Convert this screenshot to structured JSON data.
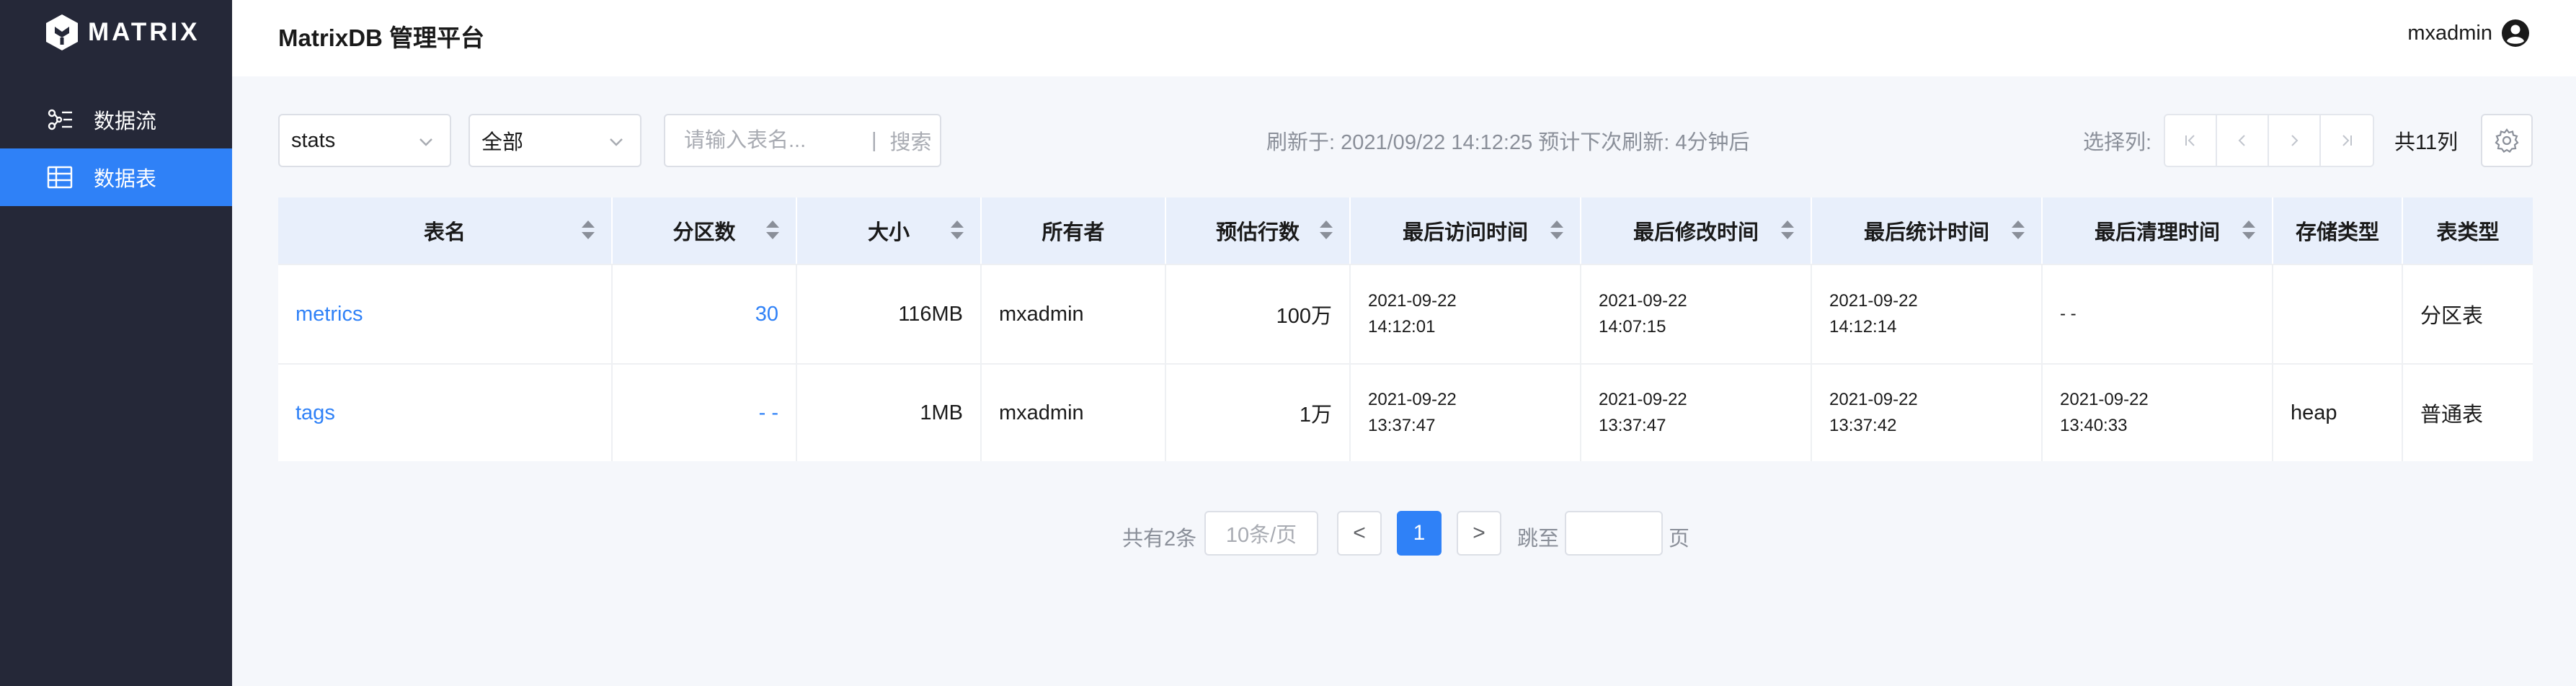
{
  "sidebar": {
    "logo_text": "MATRIX",
    "items": [
      {
        "label": "数据流",
        "icon": "data-flow-icon"
      },
      {
        "label": "数据表",
        "icon": "table-icon",
        "active": true
      }
    ]
  },
  "header": {
    "title": "MatrixDB 管理平台",
    "username": "mxadmin"
  },
  "toolbar": {
    "database_value": "stats",
    "type_value": "全部",
    "search_placeholder": "请输入表名...",
    "search_separator": "|",
    "search_button": "搜索",
    "refresh_info": "刷新于: 2021/09/22 14:12:25   预计下次刷新: 4分钟后",
    "column_select_label": "选择列:",
    "column_count": "共11列"
  },
  "table": {
    "columns": [
      "表名",
      "分区数",
      "大小",
      "所有者",
      "预估行数",
      "最后访问时间",
      "最后修改时间",
      "最后统计时间",
      "最后清理时间",
      "存储类型",
      "表类型"
    ],
    "rows": [
      {
        "name": "metrics",
        "partitions": "30",
        "size": "116MB",
        "owner": "mxadmin",
        "rows": "100万",
        "last_access": [
          "2021-09-22",
          "14:12:01"
        ],
        "last_modified": [
          "2021-09-22",
          "14:07:15"
        ],
        "last_analyzed": [
          "2021-09-22",
          "14:12:14"
        ],
        "last_vacuum": [
          "- -",
          ""
        ],
        "storage": "",
        "table_type": "分区表"
      },
      {
        "name": "tags",
        "partitions": "- -",
        "size": "1MB",
        "owner": "mxadmin",
        "rows": "1万",
        "last_access": [
          "2021-09-22",
          "13:37:47"
        ],
        "last_modified": [
          "2021-09-22",
          "13:37:47"
        ],
        "last_analyzed": [
          "2021-09-22",
          "13:37:42"
        ],
        "last_vacuum": [
          "2021-09-22",
          "13:40:33"
        ],
        "storage": "heap",
        "table_type": "普通表"
      }
    ]
  },
  "pagination": {
    "total": "共有2条",
    "page_size": "10条/页",
    "prev": "<",
    "current": "1",
    "next": ">",
    "jump_label": "跳至",
    "page_unit": "页"
  }
}
